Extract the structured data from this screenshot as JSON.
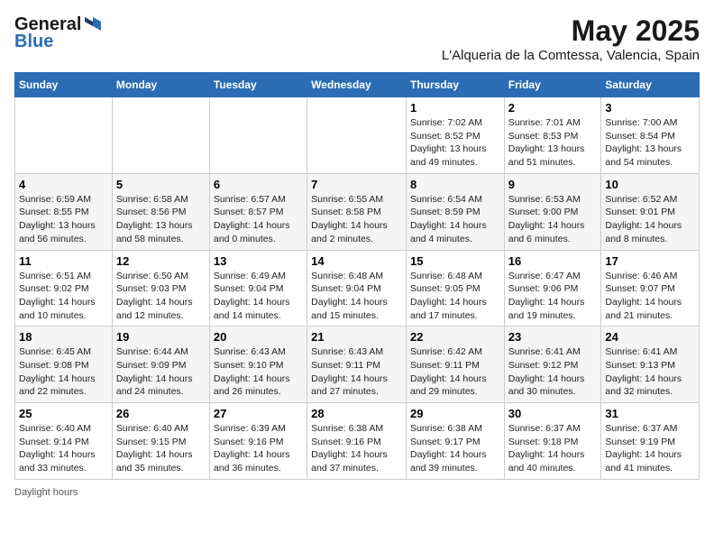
{
  "header": {
    "logo_general": "General",
    "logo_blue": "Blue",
    "month_title": "May 2025",
    "location": "L'Alqueria de la Comtessa, Valencia, Spain"
  },
  "columns": [
    "Sunday",
    "Monday",
    "Tuesday",
    "Wednesday",
    "Thursday",
    "Friday",
    "Saturday"
  ],
  "rows": [
    [
      {
        "day": "",
        "info": ""
      },
      {
        "day": "",
        "info": ""
      },
      {
        "day": "",
        "info": ""
      },
      {
        "day": "",
        "info": ""
      },
      {
        "day": "1",
        "info": "Sunrise: 7:02 AM\nSunset: 8:52 PM\nDaylight: 13 hours\nand 49 minutes."
      },
      {
        "day": "2",
        "info": "Sunrise: 7:01 AM\nSunset: 8:53 PM\nDaylight: 13 hours\nand 51 minutes."
      },
      {
        "day": "3",
        "info": "Sunrise: 7:00 AM\nSunset: 8:54 PM\nDaylight: 13 hours\nand 54 minutes."
      }
    ],
    [
      {
        "day": "4",
        "info": "Sunrise: 6:59 AM\nSunset: 8:55 PM\nDaylight: 13 hours\nand 56 minutes."
      },
      {
        "day": "5",
        "info": "Sunrise: 6:58 AM\nSunset: 8:56 PM\nDaylight: 13 hours\nand 58 minutes."
      },
      {
        "day": "6",
        "info": "Sunrise: 6:57 AM\nSunset: 8:57 PM\nDaylight: 14 hours\nand 0 minutes."
      },
      {
        "day": "7",
        "info": "Sunrise: 6:55 AM\nSunset: 8:58 PM\nDaylight: 14 hours\nand 2 minutes."
      },
      {
        "day": "8",
        "info": "Sunrise: 6:54 AM\nSunset: 8:59 PM\nDaylight: 14 hours\nand 4 minutes."
      },
      {
        "day": "9",
        "info": "Sunrise: 6:53 AM\nSunset: 9:00 PM\nDaylight: 14 hours\nand 6 minutes."
      },
      {
        "day": "10",
        "info": "Sunrise: 6:52 AM\nSunset: 9:01 PM\nDaylight: 14 hours\nand 8 minutes."
      }
    ],
    [
      {
        "day": "11",
        "info": "Sunrise: 6:51 AM\nSunset: 9:02 PM\nDaylight: 14 hours\nand 10 minutes."
      },
      {
        "day": "12",
        "info": "Sunrise: 6:50 AM\nSunset: 9:03 PM\nDaylight: 14 hours\nand 12 minutes."
      },
      {
        "day": "13",
        "info": "Sunrise: 6:49 AM\nSunset: 9:04 PM\nDaylight: 14 hours\nand 14 minutes."
      },
      {
        "day": "14",
        "info": "Sunrise: 6:48 AM\nSunset: 9:04 PM\nDaylight: 14 hours\nand 15 minutes."
      },
      {
        "day": "15",
        "info": "Sunrise: 6:48 AM\nSunset: 9:05 PM\nDaylight: 14 hours\nand 17 minutes."
      },
      {
        "day": "16",
        "info": "Sunrise: 6:47 AM\nSunset: 9:06 PM\nDaylight: 14 hours\nand 19 minutes."
      },
      {
        "day": "17",
        "info": "Sunrise: 6:46 AM\nSunset: 9:07 PM\nDaylight: 14 hours\nand 21 minutes."
      }
    ],
    [
      {
        "day": "18",
        "info": "Sunrise: 6:45 AM\nSunset: 9:08 PM\nDaylight: 14 hours\nand 22 minutes."
      },
      {
        "day": "19",
        "info": "Sunrise: 6:44 AM\nSunset: 9:09 PM\nDaylight: 14 hours\nand 24 minutes."
      },
      {
        "day": "20",
        "info": "Sunrise: 6:43 AM\nSunset: 9:10 PM\nDaylight: 14 hours\nand 26 minutes."
      },
      {
        "day": "21",
        "info": "Sunrise: 6:43 AM\nSunset: 9:11 PM\nDaylight: 14 hours\nand 27 minutes."
      },
      {
        "day": "22",
        "info": "Sunrise: 6:42 AM\nSunset: 9:11 PM\nDaylight: 14 hours\nand 29 minutes."
      },
      {
        "day": "23",
        "info": "Sunrise: 6:41 AM\nSunset: 9:12 PM\nDaylight: 14 hours\nand 30 minutes."
      },
      {
        "day": "24",
        "info": "Sunrise: 6:41 AM\nSunset: 9:13 PM\nDaylight: 14 hours\nand 32 minutes."
      }
    ],
    [
      {
        "day": "25",
        "info": "Sunrise: 6:40 AM\nSunset: 9:14 PM\nDaylight: 14 hours\nand 33 minutes."
      },
      {
        "day": "26",
        "info": "Sunrise: 6:40 AM\nSunset: 9:15 PM\nDaylight: 14 hours\nand 35 minutes."
      },
      {
        "day": "27",
        "info": "Sunrise: 6:39 AM\nSunset: 9:16 PM\nDaylight: 14 hours\nand 36 minutes."
      },
      {
        "day": "28",
        "info": "Sunrise: 6:38 AM\nSunset: 9:16 PM\nDaylight: 14 hours\nand 37 minutes."
      },
      {
        "day": "29",
        "info": "Sunrise: 6:38 AM\nSunset: 9:17 PM\nDaylight: 14 hours\nand 39 minutes."
      },
      {
        "day": "30",
        "info": "Sunrise: 6:37 AM\nSunset: 9:18 PM\nDaylight: 14 hours\nand 40 minutes."
      },
      {
        "day": "31",
        "info": "Sunrise: 6:37 AM\nSunset: 9:19 PM\nDaylight: 14 hours\nand 41 minutes."
      }
    ]
  ],
  "footer": {
    "daylight_label": "Daylight hours"
  }
}
